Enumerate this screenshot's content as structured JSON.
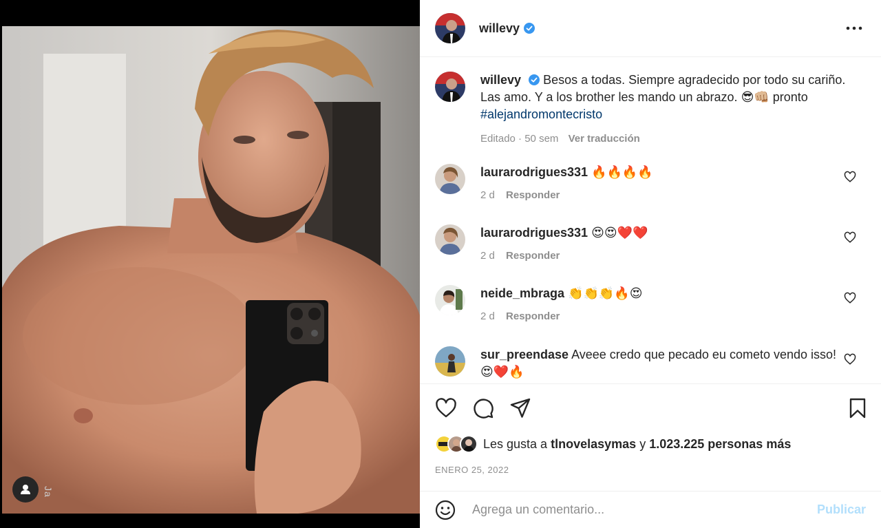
{
  "post": {
    "username": "willevy",
    "more_icon": "more-horizontal-icon",
    "media_watermark": "Ja"
  },
  "caption": {
    "username": "willevy",
    "text_1": "Besos a todas. Siempre agradecido por todo su cariño. Las amo. Y a los brother les mando un abrazo.",
    "emojis": "😎👊🏼",
    "text_2": "pronto",
    "hashtag": "#alejandromontecristo",
    "edited": "Editado",
    "time": "50 sem",
    "translate": "Ver traducción"
  },
  "comments": [
    {
      "username": "laurarodrigues331",
      "text": "",
      "emojis": "🔥🔥🔥🔥",
      "time": "2 d",
      "reply": "Responder"
    },
    {
      "username": "laurarodrigues331",
      "text": "",
      "emojis": "😍😍❤️❤️",
      "time": "2 d",
      "reply": "Responder"
    },
    {
      "username": "neide_mbraga",
      "text": "",
      "emojis": "👏👏👏🔥😍",
      "time": "2 d",
      "reply": "Responder"
    },
    {
      "username": "sur_preendase",
      "text": "Aveee credo que pecado eu cometo vendo isso!",
      "emojis": "😍❤️🔥",
      "time": "",
      "reply": ""
    }
  ],
  "likes": {
    "prefix": "Les gusta a",
    "user": "tlnovelasymas",
    "conj": "y",
    "count": "1.023.225 personas más"
  },
  "date": "ENERO 25, 2022",
  "add_comment": {
    "placeholder": "Agrega un comentario...",
    "publish": "Publicar"
  },
  "colors": {
    "accent": "#0095f6",
    "publish_disabled": "#b2dffc",
    "hashtag": "#00376b",
    "muted": "#8e8e8e",
    "verified": "#3897f0"
  }
}
